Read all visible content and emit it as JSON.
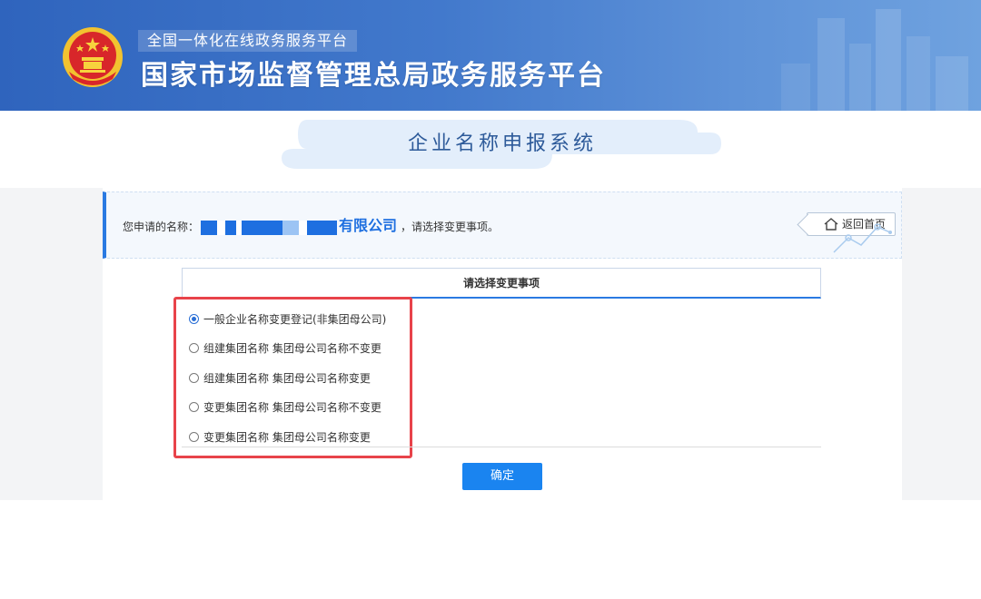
{
  "header": {
    "platform_tag": "全国一体化在线政务服务平台",
    "site_title": "国家市场监督管理总局政务服务平台",
    "emblem_icon": "national-emblem-icon"
  },
  "system": {
    "title": "企业名称申报系统"
  },
  "info": {
    "label": "您申请的名称：",
    "company_suffix": "有限公司",
    "hint": "，请选择变更事项。",
    "home_label": "返回首页",
    "home_icon": "home-icon"
  },
  "options": {
    "header": "请选择变更事项",
    "items": [
      {
        "label": "一般企业名称变更登记(非集团母公司)",
        "checked": true
      },
      {
        "label": "组建集团名称 集团母公司名称不变更",
        "checked": false
      },
      {
        "label": "组建集团名称 集团母公司名称变更",
        "checked": false
      },
      {
        "label": "变更集团名称 集团母公司名称不变更",
        "checked": false
      },
      {
        "label": "变更集团名称 集团母公司名称变更",
        "checked": false
      }
    ]
  },
  "actions": {
    "confirm_label": "确定"
  },
  "colors": {
    "accent": "#1a84f0",
    "highlight": "#e8434a",
    "banner": "#3f74c8"
  }
}
